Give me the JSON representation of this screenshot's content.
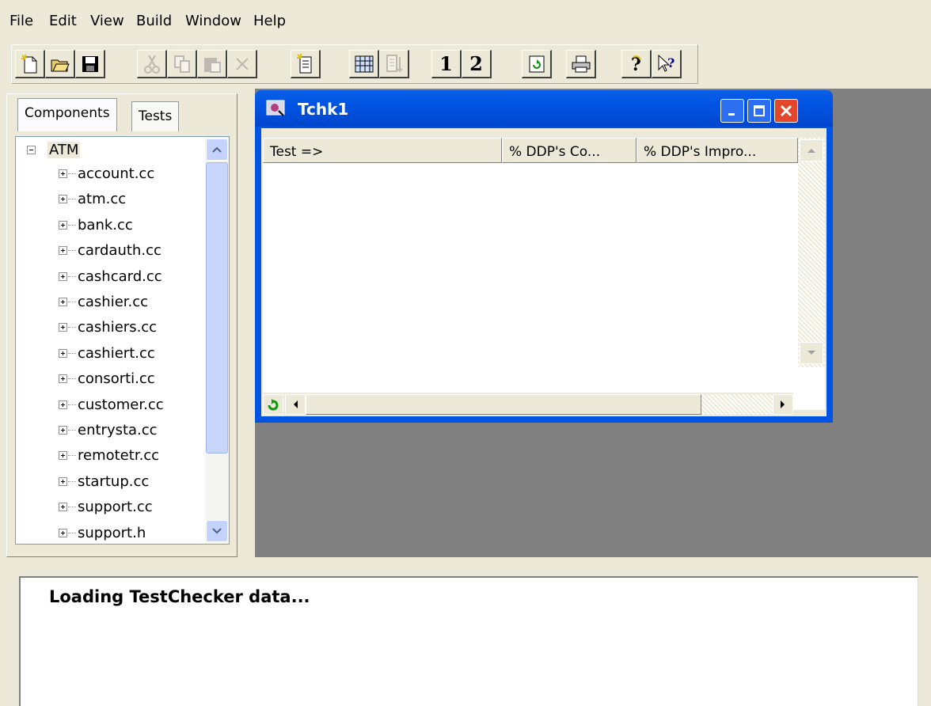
{
  "menu": [
    "File",
    "Edit",
    "View",
    "Build",
    "Window",
    "Help"
  ],
  "toolbar": {
    "buttons": [
      {
        "name": "new-icon",
        "enabled": true
      },
      {
        "name": "open-folder-icon",
        "enabled": true
      },
      {
        "name": "save-icon",
        "enabled": true
      },
      {
        "name": "cut-icon",
        "enabled": false
      },
      {
        "name": "copy-icon",
        "enabled": false
      },
      {
        "name": "paste-icon",
        "enabled": false
      },
      {
        "name": "delete-icon",
        "enabled": false
      },
      {
        "name": "properties-icon",
        "enabled": true
      },
      {
        "name": "grid-icon",
        "enabled": true
      },
      {
        "name": "sort-icon",
        "enabled": false
      },
      {
        "name": "view-1-icon",
        "label": "1",
        "enabled": true
      },
      {
        "name": "view-2-icon",
        "label": "2",
        "enabled": true
      },
      {
        "name": "refresh-icon",
        "enabled": true
      },
      {
        "name": "print-icon",
        "enabled": true
      },
      {
        "name": "help-icon",
        "enabled": true
      },
      {
        "name": "context-help-icon",
        "enabled": true
      }
    ]
  },
  "left_panel": {
    "tabs": [
      "Components",
      "Tests"
    ],
    "active_tab": "Components",
    "tree": {
      "root": "ATM",
      "items": [
        "account.cc",
        "atm.cc",
        "bank.cc",
        "cardauth.cc",
        "cashcard.cc",
        "cashier.cc",
        "cashiers.cc",
        "cashiert.cc",
        "consorti.cc",
        "customer.cc",
        "entrysta.cc",
        "remotetr.cc",
        "startup.cc",
        "support.cc",
        "support.h"
      ]
    }
  },
  "child_window": {
    "title": "Tchk1",
    "columns": [
      "Test  =>",
      "% DDP's Co...",
      "% DDP's Impro..."
    ]
  },
  "status": {
    "message": "Loading TestChecker data..."
  },
  "colors": {
    "title_bar": "#0054e3",
    "close_button": "#e2472b",
    "mdi_background": "#808080",
    "chrome": "#ece9d8"
  }
}
